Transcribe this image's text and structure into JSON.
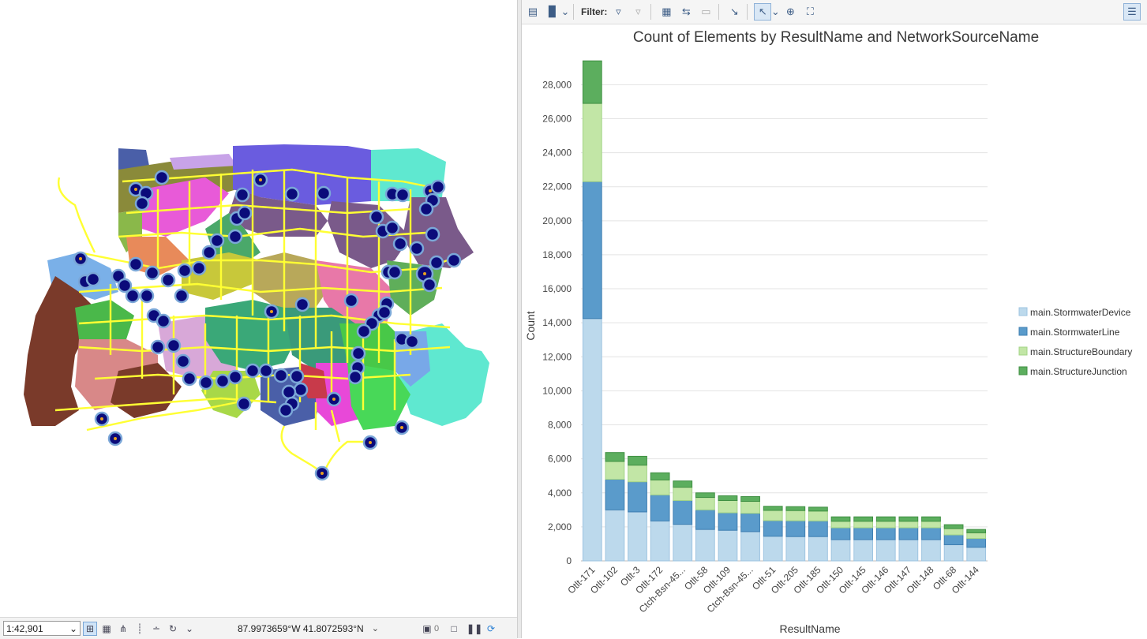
{
  "map": {
    "scale": "1:42,901",
    "coordinates": "87.9973659°W 41.8072593°N",
    "selection_count": "0"
  },
  "chart_toolbar": {
    "filter_label": "Filter:"
  },
  "icons": {
    "map_nav": "map-navigation-icon",
    "grid": "grid-icon",
    "snapping": "snapping-icon",
    "ruler": "ruler-icon",
    "correction": "correction-icon",
    "pause": "pause-icon",
    "refresh": "refresh-icon"
  },
  "colors": {
    "series_device": "#bcd9ec",
    "series_line": "#5a9bcb",
    "series_boundary": "#c2e6a6",
    "series_junction": "#5cae5e",
    "network_lines": "#ffff33",
    "markers": "#0b0b7a"
  },
  "chart_data": {
    "type": "bar",
    "title": "Count of Elements by ResultName and NetworkSourceName",
    "xlabel": "ResultName",
    "ylabel": "Count",
    "ylim": [
      0,
      29500
    ],
    "yticks": [
      0,
      2000,
      4000,
      6000,
      8000,
      10000,
      12000,
      14000,
      16000,
      18000,
      20000,
      22000,
      24000,
      26000,
      28000
    ],
    "ytick_labels": [
      "0",
      "2,000",
      "4,000",
      "6,000",
      "8,000",
      "10,000",
      "12,000",
      "14,000",
      "16,000",
      "18,000",
      "20,000",
      "22,000",
      "24,000",
      "26,000",
      "28,000"
    ],
    "stacked": true,
    "grid": true,
    "legend_position": "right",
    "categories": [
      "Otlt-171",
      "Otlt-102",
      "Otlt-3",
      "Otlt-172",
      "Ctch-Bsn-45...",
      "Otlt-58",
      "Otlt-109",
      "Ctch-Bsn-45...",
      "Otlt-51",
      "Otlt-205",
      "Otlt-185",
      "Otlt-150",
      "Otlt-145",
      "Otlt-146",
      "Otlt-147",
      "Otlt-148",
      "Otlt-68",
      "Otlt-144"
    ],
    "series": [
      {
        "name": "main.StormwaterDevice",
        "values": [
          14250,
          3000,
          2880,
          2350,
          2150,
          1850,
          1800,
          1720,
          1450,
          1430,
          1430,
          1250,
          1250,
          1250,
          1250,
          1250,
          950,
          800
        ]
      },
      {
        "name": "main.StormwaterLine",
        "values": [
          8050,
          1800,
          1770,
          1530,
          1400,
          1150,
          1030,
          1080,
          920,
          930,
          920,
          700,
          700,
          700,
          700,
          700,
          580,
          520
        ]
      },
      {
        "name": "main.StructureBoundary",
        "values": [
          4600,
          1050,
          980,
          880,
          780,
          730,
          720,
          700,
          600,
          600,
          580,
          380,
          380,
          380,
          380,
          380,
          370,
          330
        ]
      },
      {
        "name": "main.StructureJunction",
        "values": [
          2500,
          520,
          520,
          420,
          370,
          270,
          280,
          280,
          240,
          230,
          230,
          260,
          260,
          260,
          260,
          260,
          230,
          200
        ]
      }
    ]
  }
}
